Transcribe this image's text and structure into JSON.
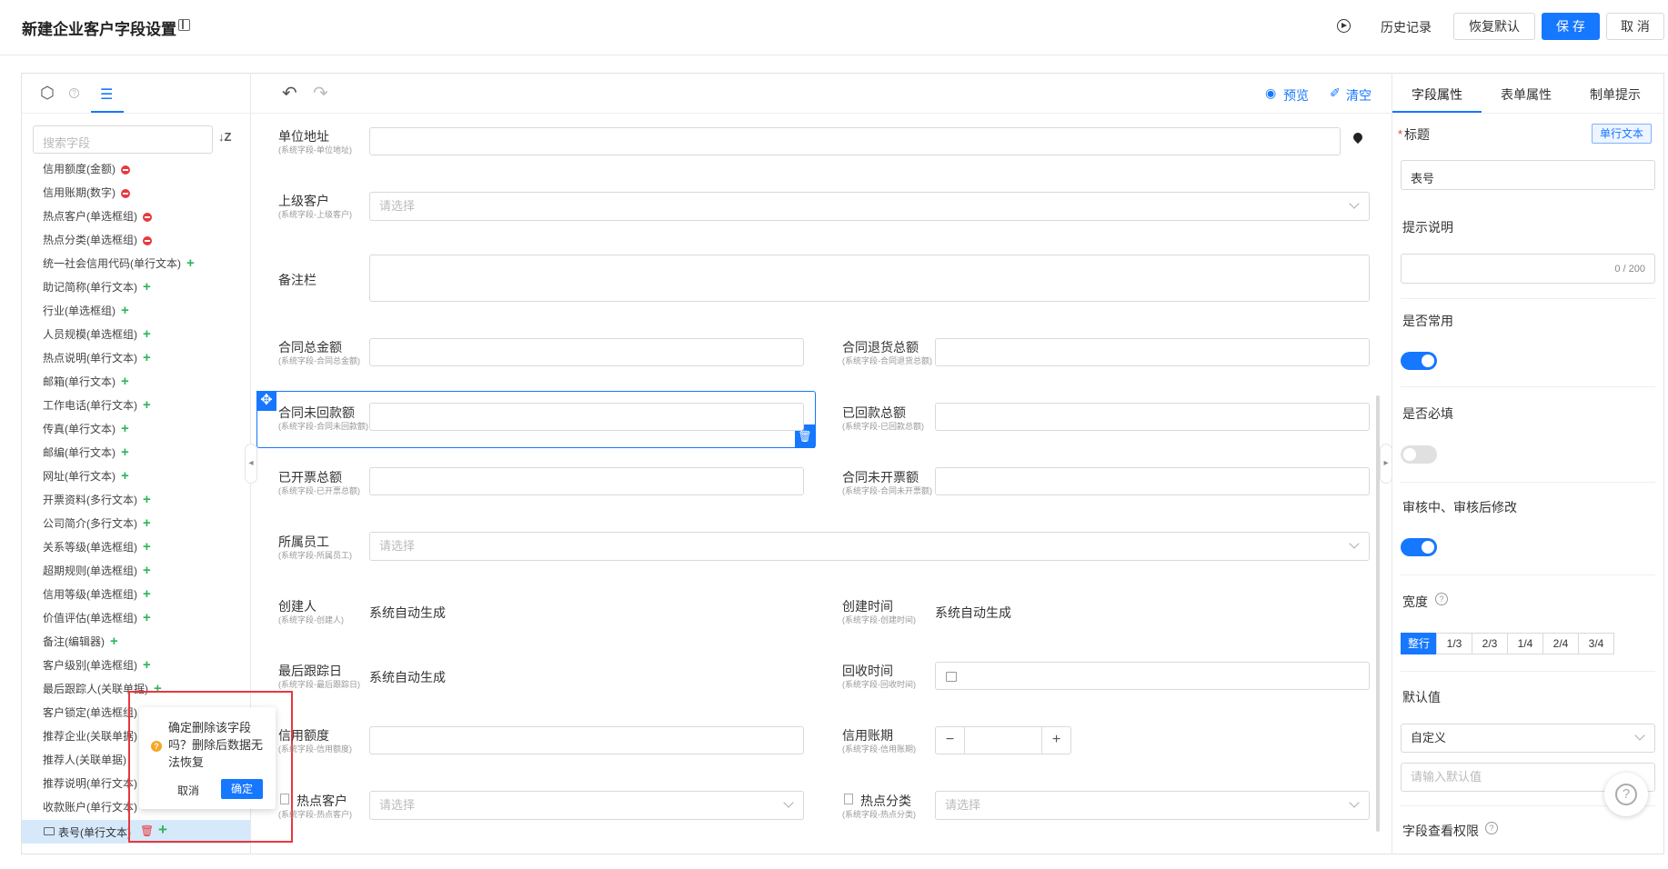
{
  "header": {
    "title": "新建企业客户字段设置",
    "history": "历史记录",
    "restore": "恢复默认",
    "save": "保 存",
    "cancel": "取 消"
  },
  "left": {
    "search_placeholder": "搜索字段",
    "fields": [
      {
        "label": "信用额度(金额)",
        "action": "remove"
      },
      {
        "label": "信用账期(数字)",
        "action": "remove"
      },
      {
        "label": "热点客户(单选框组)",
        "action": "remove"
      },
      {
        "label": "热点分类(单选框组)",
        "action": "remove"
      },
      {
        "label": "统一社会信用代码(单行文本)",
        "action": "add"
      },
      {
        "label": "助记简称(单行文本)",
        "action": "add"
      },
      {
        "label": "行业(单选框组)",
        "action": "add"
      },
      {
        "label": "人员规模(单选框组)",
        "action": "add"
      },
      {
        "label": "热点说明(单行文本)",
        "action": "add"
      },
      {
        "label": "邮箱(单行文本)",
        "action": "add"
      },
      {
        "label": "工作电话(单行文本)",
        "action": "add"
      },
      {
        "label": "传真(单行文本)",
        "action": "add"
      },
      {
        "label": "邮编(单行文本)",
        "action": "add"
      },
      {
        "label": "网址(单行文本)",
        "action": "add"
      },
      {
        "label": "开票资料(多行文本)",
        "action": "add"
      },
      {
        "label": "公司简介(多行文本)",
        "action": "add"
      },
      {
        "label": "关系等级(单选框组)",
        "action": "add"
      },
      {
        "label": "超期规则(单选框组)",
        "action": "add"
      },
      {
        "label": "信用等级(单选框组)",
        "action": "add"
      },
      {
        "label": "价值评估(单选框组)",
        "action": "add"
      },
      {
        "label": "备注(编辑器)",
        "action": "add"
      },
      {
        "label": "客户级别(单选框组)",
        "action": "add"
      },
      {
        "label": "最后跟踪人(关联单据)",
        "action": "add"
      },
      {
        "label": "客户锁定(单选框组)",
        "action": ""
      },
      {
        "label": "推荐企业(关联单据)",
        "action": ""
      },
      {
        "label": "推荐人(关联单据)",
        "action": ""
      },
      {
        "label": "推荐说明(单行文本)",
        "action": ""
      },
      {
        "label": "收款账户(单行文本)",
        "action": ""
      }
    ],
    "selected": "表号(单行文本)"
  },
  "popconfirm": {
    "message": "确定删除该字段吗？删除后数据无法恢复",
    "cancel": "取消",
    "ok": "确定"
  },
  "center": {
    "preview": "预览",
    "clear": "清空",
    "select_placeholder": "请选择",
    "auto_text": "系统自动生成",
    "fields": {
      "address": {
        "label": "单位地址",
        "sub": "(系统字段-单位地址)"
      },
      "parent": {
        "label": "上级客户",
        "sub": "(系统字段-上级客户)"
      },
      "remark": {
        "label": "备注栏"
      },
      "contract_total": {
        "label": "合同总金额",
        "sub": "(系统字段-合同总金额)"
      },
      "contract_return": {
        "label": "合同退货总额",
        "sub": "(系统字段-合同退货总额)"
      },
      "contract_unpaid": {
        "label": "合同未回款额",
        "sub": "(系统字段-合同未回款额)"
      },
      "paid_total": {
        "label": "已回款总额",
        "sub": "(系统字段-已回款总额)"
      },
      "invoiced_total": {
        "label": "已开票总额",
        "sub": "(系统字段-已开票总额)"
      },
      "uninvoiced": {
        "label": "合同未开票额",
        "sub": "(系统字段-合同未开票额)"
      },
      "owner": {
        "label": "所属员工",
        "sub": "(系统字段-所属员工)"
      },
      "creator": {
        "label": "创建人",
        "sub": "(系统字段-创建人)"
      },
      "created_time": {
        "label": "创建时间",
        "sub": "(系统字段-创建时间)"
      },
      "last_follow": {
        "label": "最后跟踪日",
        "sub": "(系统字段-最后跟踪日)"
      },
      "recycle_time": {
        "label": "回收时间",
        "sub": "(系统字段-回收时间)"
      },
      "credit_amount": {
        "label": "信用额度",
        "sub": "(系统字段-信用额度)"
      },
      "credit_period": {
        "label": "信用账期",
        "sub": "(系统字段-信用账期)"
      },
      "hot_customer": {
        "label": "热点客户",
        "sub": "(系统字段-热点客户)"
      },
      "hot_category": {
        "label": "热点分类",
        "sub": "(系统字段-热点分类)"
      }
    }
  },
  "right": {
    "tabs": [
      "字段属性",
      "表单属性",
      "制单提示"
    ],
    "title_label": "标题",
    "type_tag": "单行文本",
    "title_value": "表号",
    "hint_label": "提示说明",
    "hint_counter": "0 / 200",
    "common_label": "是否常用",
    "common_on": true,
    "required_label": "是否必填",
    "required_on": false,
    "audit_label": "审核中、审核后修改",
    "audit_on": true,
    "width_label": "宽度",
    "width_options": [
      "整行",
      "1/3",
      "2/3",
      "1/4",
      "2/4",
      "3/4"
    ],
    "width_selected": "整行",
    "default_label": "默认值",
    "default_mode": "自定义",
    "default_placeholder": "请输入默认值",
    "permission_label": "字段查看权限"
  },
  "colors": {
    "primary": "#1677ff",
    "danger": "#e8383d",
    "add": "#2db55d",
    "warn": "#f5a623"
  }
}
